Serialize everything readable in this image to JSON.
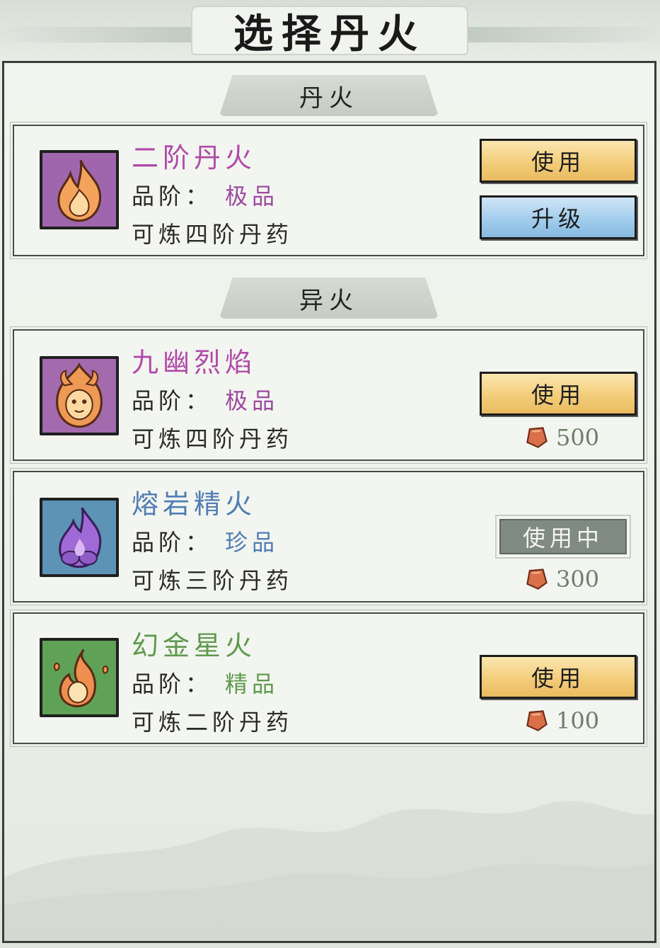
{
  "title": "选择丹火",
  "sections": {
    "dan_fire": {
      "label": "丹火"
    },
    "strange_fire": {
      "label": "异火"
    }
  },
  "grade_label": "品阶：",
  "cards": [
    {
      "name": "二阶丹火",
      "name_color": "#b04aa8",
      "grade": "极品",
      "grade_color": "#9c4aa0",
      "desc": "可炼四阶丹药",
      "icon": "flame-icon",
      "icon_bg": "#9f66ad",
      "buttons": {
        "use": "使用",
        "upgrade": "升级"
      }
    },
    {
      "name": "九幽烈焰",
      "name_color": "#b04aa8",
      "grade": "极品",
      "grade_color": "#9c4aa0",
      "desc": "可炼四阶丹药",
      "icon": "demon-flame-icon",
      "icon_bg": "#a36aae",
      "buttons": {
        "use": "使用"
      },
      "cost": "500"
    },
    {
      "name": "熔岩精火",
      "name_color": "#4f7db3",
      "grade": "珍品",
      "grade_color": "#4f7db3",
      "desc": "可炼三阶丹药",
      "icon": "purple-flame-icon",
      "icon_bg": "#5d93b6",
      "buttons": {
        "in_use": "使用中"
      },
      "cost": "300"
    },
    {
      "name": "幻金星火",
      "name_color": "#5e9a4e",
      "grade": "精品",
      "grade_color": "#5e9a4e",
      "desc": "可炼二阶丹药",
      "icon": "spark-flame-icon",
      "icon_bg": "#5fa257",
      "buttons": {
        "use": "使用"
      },
      "cost": "100"
    }
  ],
  "colors": {
    "gold_button": "#f3cd7a",
    "blue_button": "#9fcbec",
    "in_use_button": "#7f8a83",
    "cost_gem": "#d9704a"
  }
}
